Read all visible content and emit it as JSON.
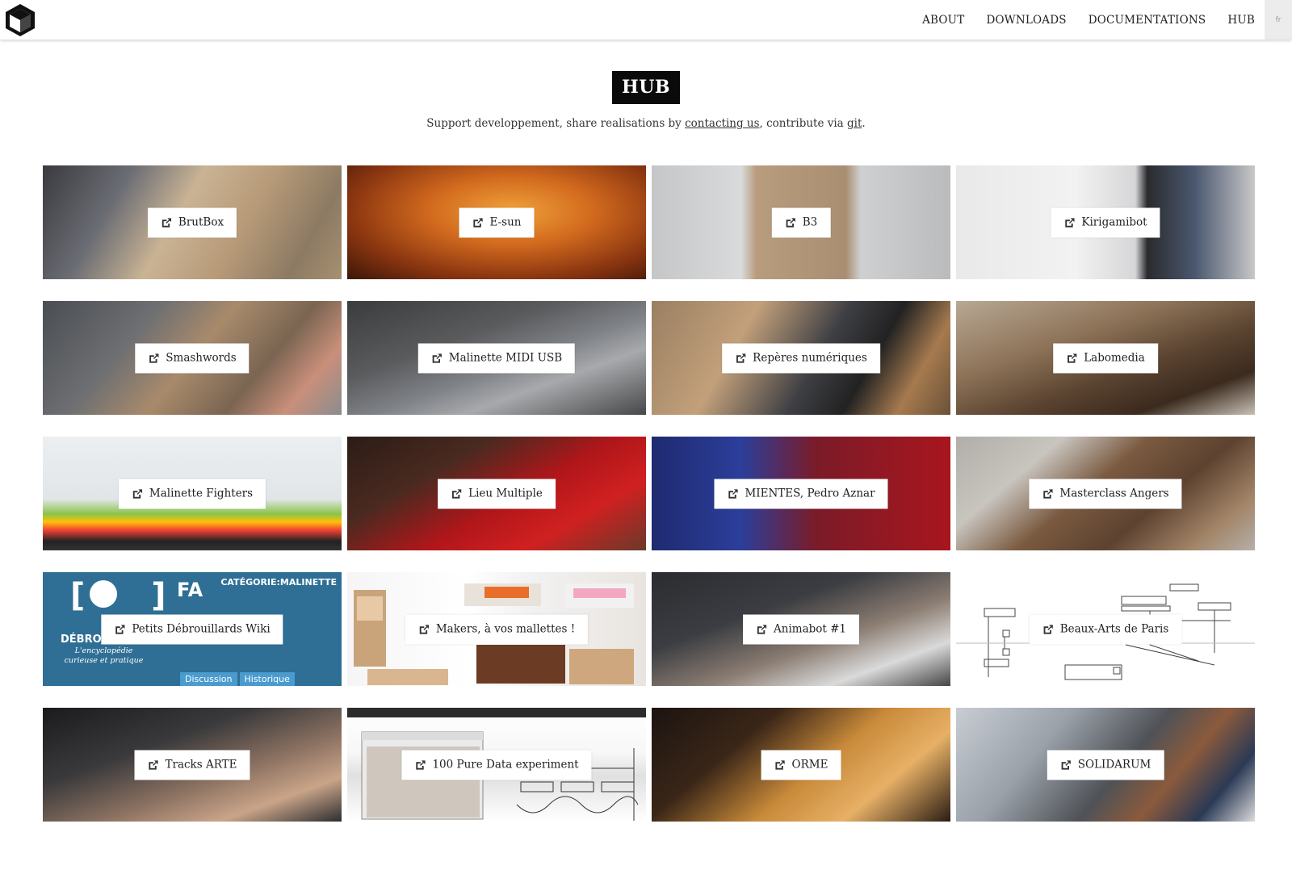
{
  "header": {
    "nav": [
      {
        "id": "about",
        "label": "ABOUT"
      },
      {
        "id": "downloads",
        "label": "DOWNLOADS"
      },
      {
        "id": "documentations",
        "label": "DOCUMENTATIONS"
      },
      {
        "id": "hub",
        "label": "HUB"
      }
    ],
    "lang": "fr"
  },
  "page": {
    "title": "HUB",
    "subtitle_before": "Support developpement, share realisations by ",
    "contact_link": "contacting us",
    "subtitle_middle": ", contribute via ",
    "git_link": "git",
    "subtitle_after": "."
  },
  "projects": [
    {
      "label": "BrutBox"
    },
    {
      "label": "E-sun"
    },
    {
      "label": "B3"
    },
    {
      "label": "Kirigamibot"
    },
    {
      "label": "Smashwords"
    },
    {
      "label": "Malinette MIDI USB"
    },
    {
      "label": "Repères numériques"
    },
    {
      "label": "Labomedia"
    },
    {
      "label": "Malinette Fighters"
    },
    {
      "label": "Lieu Multiple"
    },
    {
      "label": "MIENTES, Pedro Aznar"
    },
    {
      "label": "Masterclass Angers"
    },
    {
      "label": "Petits Débrouillards Wiki"
    },
    {
      "label": "Makers, à vos mallettes !"
    },
    {
      "label": "Animabot #1"
    },
    {
      "label": "Beaux-Arts de Paris"
    },
    {
      "label": "Tracks ARTE"
    },
    {
      "label": "100 Pure Data experiment"
    },
    {
      "label": "ORME"
    },
    {
      "label": "SOLIDARUM"
    }
  ],
  "wiki_tile": {
    "category": "CATÉGORIE:MALINETTE",
    "fa": "FA",
    "debrouillards": "DÉBROUILLARDS",
    "tagline": "L'encyclopédie curieuse et pratique",
    "tabs": [
      "Discussion",
      "Historique"
    ]
  },
  "icon": "external-link-icon",
  "colors": {
    "title_bg": "#0a0a0a",
    "title_fg": "#ffffff",
    "wiki_blue": "#2f6f96"
  }
}
